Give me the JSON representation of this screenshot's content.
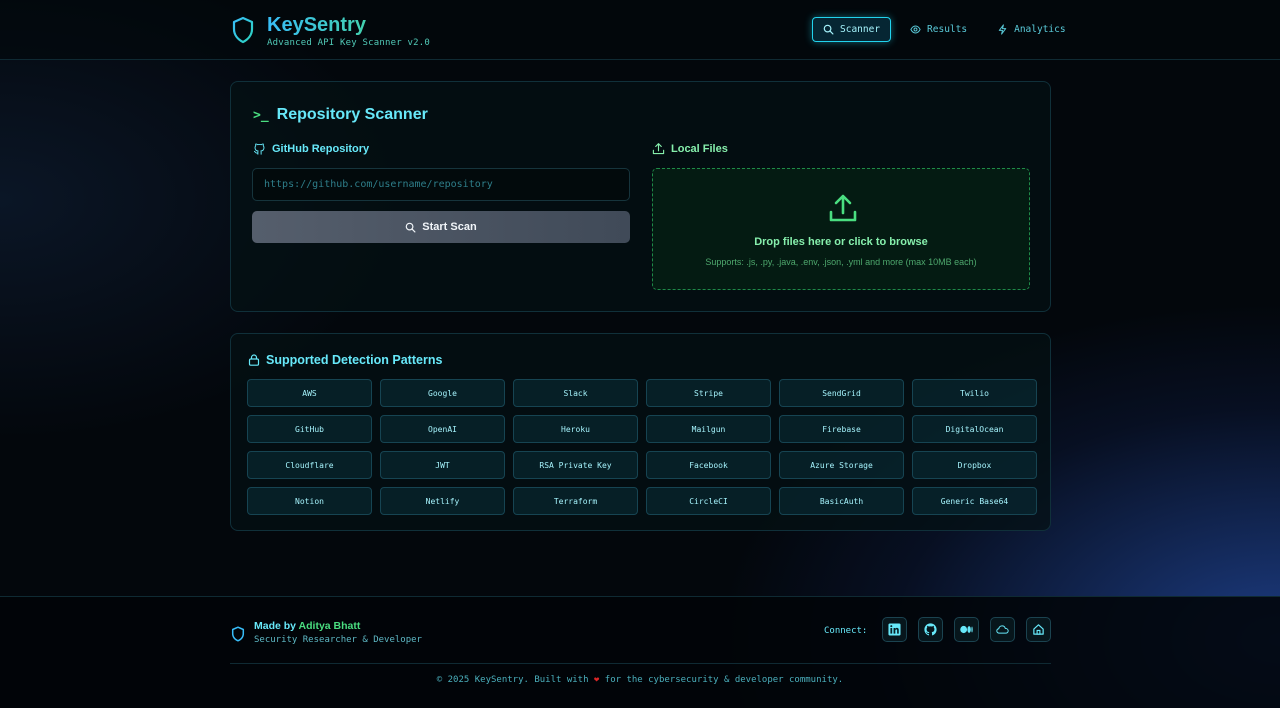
{
  "header": {
    "title": "KeySentry",
    "subtitle": "Advanced API Key Scanner v2.0",
    "nav": [
      {
        "label": "Scanner",
        "icon": "search-icon",
        "active": true
      },
      {
        "label": "Results",
        "icon": "eye-icon",
        "active": false
      },
      {
        "label": "Analytics",
        "icon": "lightning-icon",
        "active": false
      }
    ]
  },
  "scanner": {
    "title": "Repository Scanner",
    "github": {
      "label": "GitHub Repository",
      "placeholder": "https://github.com/username/repository",
      "value": "",
      "button_label": "Start Scan"
    },
    "local": {
      "label": "Local Files",
      "drop_title": "Drop files here or click to browse",
      "drop_sub": "Supports: .js, .py, .java, .env, .json, .yml and more (max 10MB each)"
    }
  },
  "patterns": {
    "title": "Supported Detection Patterns",
    "items": [
      "AWS",
      "Google",
      "Slack",
      "Stripe",
      "SendGrid",
      "Twilio",
      "GitHub",
      "OpenAI",
      "Heroku",
      "Mailgun",
      "Firebase",
      "DigitalOcean",
      "Cloudflare",
      "JWT",
      "RSA Private Key",
      "Facebook",
      "Azure Storage",
      "Dropbox",
      "Notion",
      "Netlify",
      "Terraform",
      "CircleCI",
      "BasicAuth",
      "Generic Base64"
    ]
  },
  "footer": {
    "made_by_prefix": "Made by ",
    "author": "Aditya Bhatt",
    "role": "Security Researcher & Developer",
    "connect_label": "Connect:",
    "socials": [
      "linkedin-icon",
      "github-icon",
      "medium-icon",
      "cloud-icon",
      "home-icon"
    ],
    "copyright_before": "© 2025 KeySentry. Built with",
    "copyright_after": "for the cybersecurity & developer community."
  },
  "colors": {
    "accent_cyan": "#22d3ee",
    "accent_green": "#4ade80",
    "background": "#03070c"
  }
}
